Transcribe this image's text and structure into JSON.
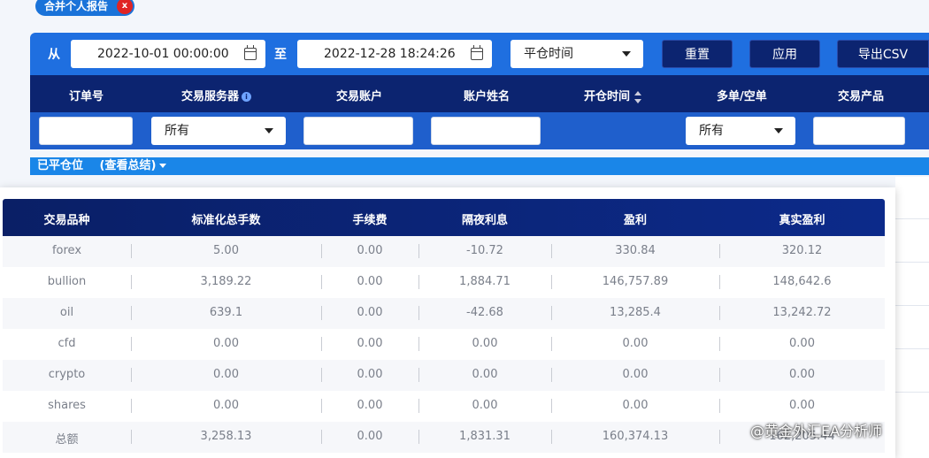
{
  "tag": {
    "label": "合并个人报告",
    "close": "x"
  },
  "filter": {
    "from_label": "从",
    "from_value": "2022-10-01 00:00:00",
    "to_label": "至",
    "to_value": "2022-12-28 18:24:26",
    "sort_select": "平仓时间",
    "reset": "重置",
    "apply": "应用",
    "export": "导出CSV"
  },
  "columns": {
    "order_no": "订单号",
    "server": "交易服务器",
    "account": "交易账户",
    "name": "账户姓名",
    "open_time": "开仓时间",
    "direction": "多单/空单",
    "product": "交易产品"
  },
  "inputs": {
    "server_select": "所有",
    "direction_select": "所有"
  },
  "closed": {
    "label": "已平仓位",
    "summary_link": "(查看总结)"
  },
  "summary": {
    "headers": [
      "交易品种",
      "标准化总手数",
      "手续费",
      "隔夜利息",
      "盈利",
      "真实盈利"
    ],
    "rows": [
      [
        "forex",
        "5.00",
        "0.00",
        "-10.72",
        "330.84",
        "320.12"
      ],
      [
        "bullion",
        "3,189.22",
        "0.00",
        "1,884.71",
        "146,757.89",
        "148,642.6"
      ],
      [
        "oil",
        "639.1",
        "0.00",
        "-42.68",
        "13,285.4",
        "13,242.72"
      ],
      [
        "cfd",
        "0.00",
        "0.00",
        "0.00",
        "0.00",
        "0.00"
      ],
      [
        "crypto",
        "0.00",
        "0.00",
        "0.00",
        "0.00",
        "0.00"
      ],
      [
        "shares",
        "0.00",
        "0.00",
        "0.00",
        "0.00",
        "0.00"
      ],
      [
        "总额",
        "3,258.13",
        "0.00",
        "1,831.31",
        "160,374.13",
        "162,205.44"
      ]
    ]
  },
  "watermark": "@黄金外汇EA分析师",
  "colors": {
    "primary": "#1f6fe0",
    "navy": "#0c2470",
    "close_red": "#e02424"
  }
}
